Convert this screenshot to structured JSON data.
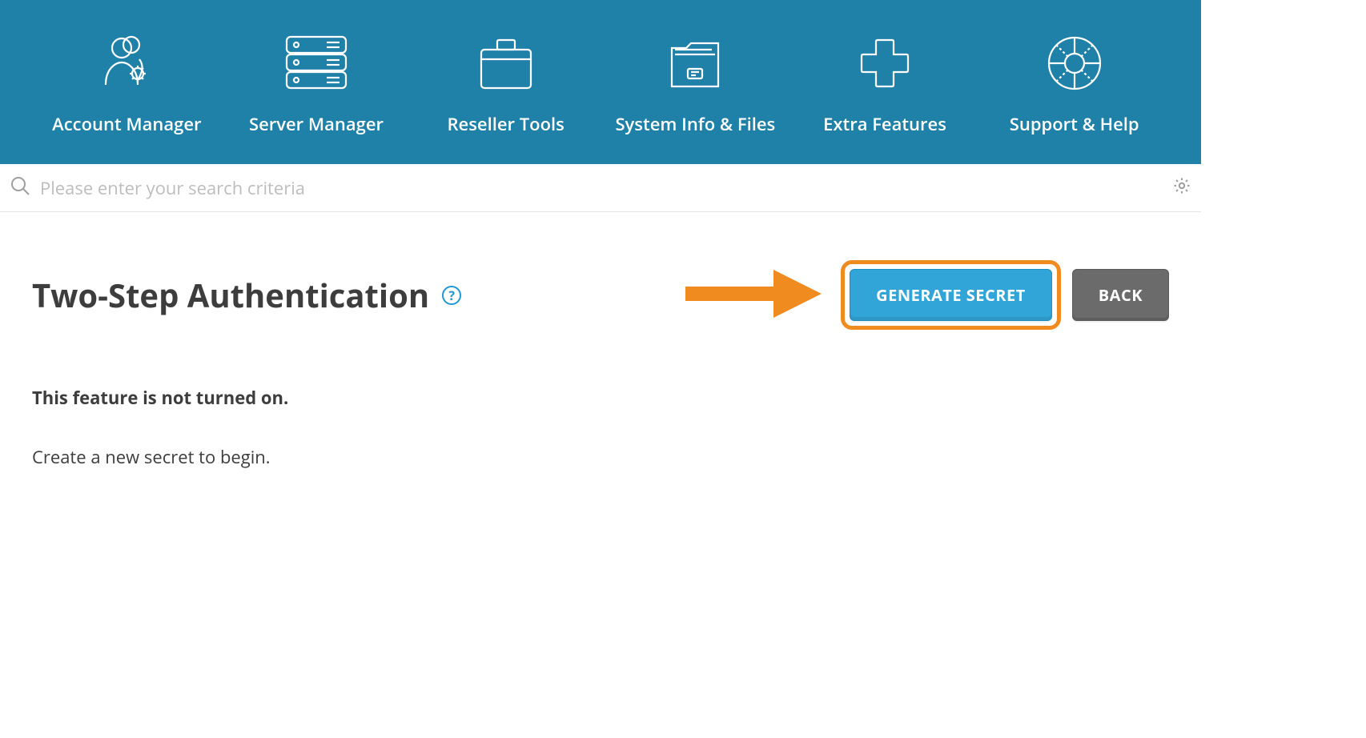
{
  "nav": {
    "items": [
      {
        "label": "Account Manager"
      },
      {
        "label": "Server Manager"
      },
      {
        "label": "Reseller Tools"
      },
      {
        "label": "System Info & Files"
      },
      {
        "label": "Extra Features"
      },
      {
        "label": "Support & Help"
      }
    ]
  },
  "search": {
    "placeholder": "Please enter your search criteria"
  },
  "page": {
    "title": "Two-Step Authentication",
    "help_tooltip": "?",
    "buttons": {
      "generate_secret": "Generate Secret",
      "back": "Back"
    },
    "status": "This feature is not turned on.",
    "hint": "Create a new secret to begin."
  },
  "annotation": {
    "arrow_color": "#f08c1f",
    "highlight_color": "#f08c1f"
  }
}
